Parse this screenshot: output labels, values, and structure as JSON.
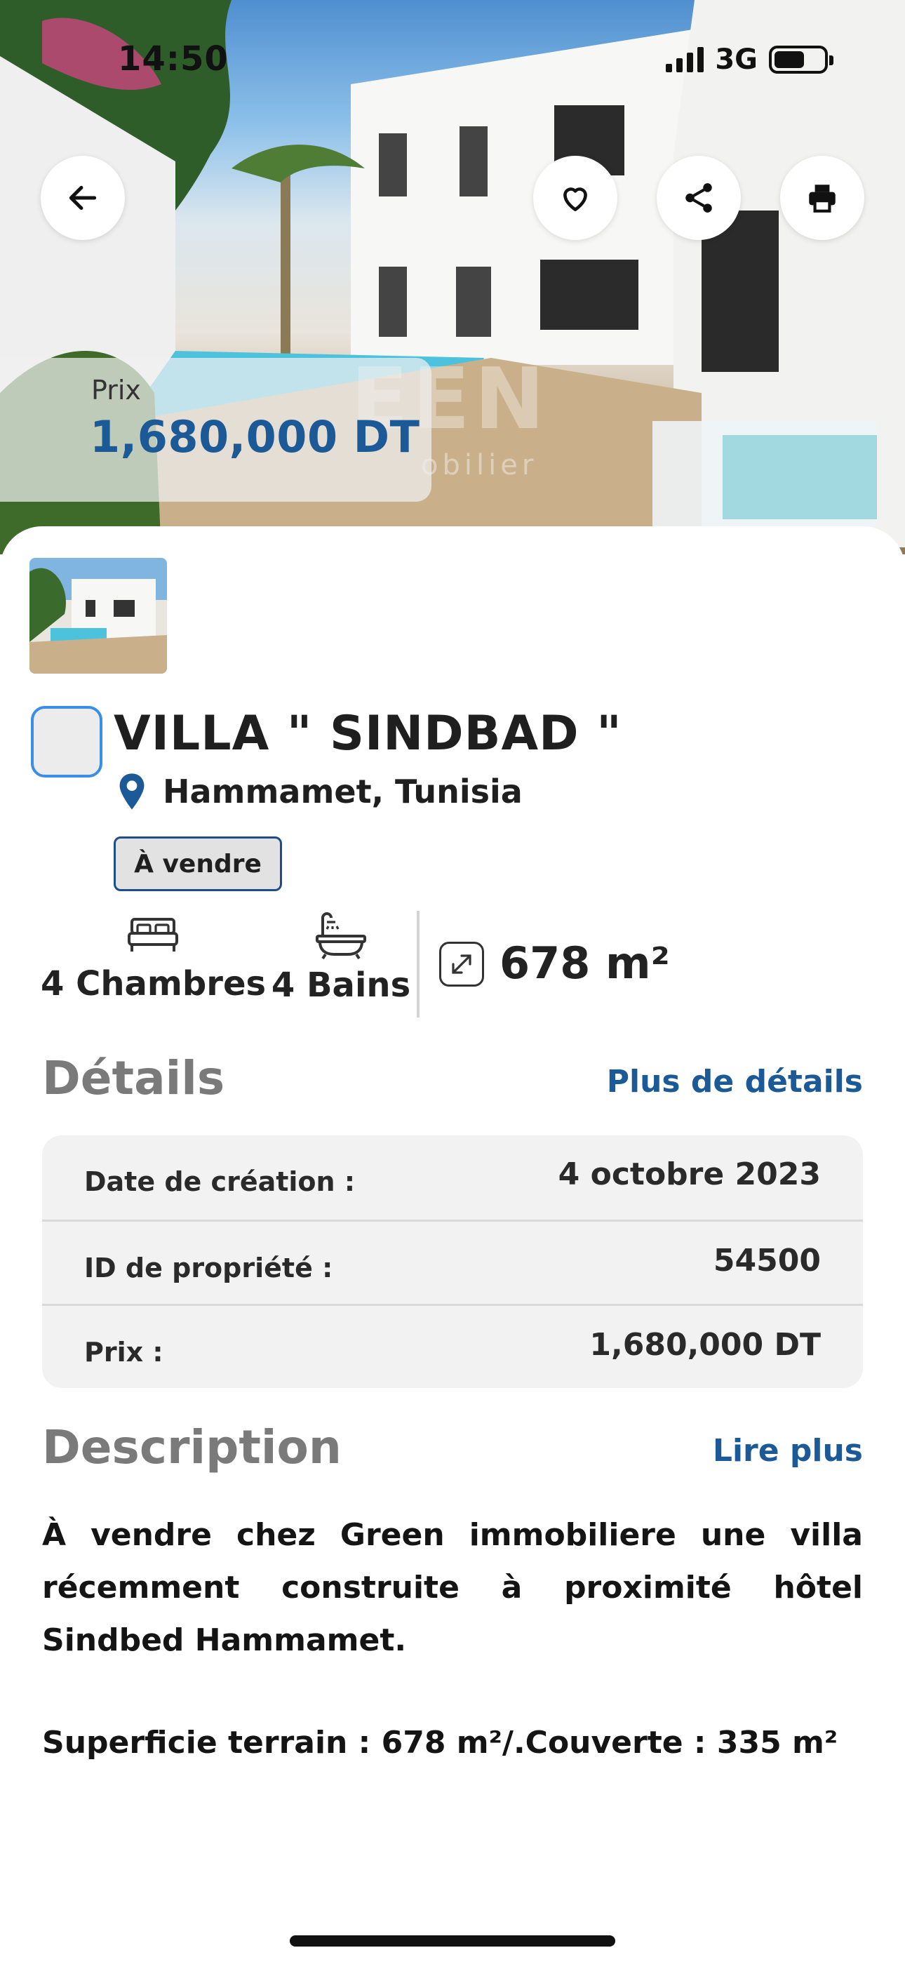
{
  "status_bar": {
    "time": "14:50",
    "network": "3G"
  },
  "hero": {
    "price_label": "Prix",
    "price_value": "1,680,000 DT",
    "watermark": "EEN",
    "watermark_sub": "obilier"
  },
  "listing": {
    "title": "VILLA \" SINDBAD \"",
    "location": "Hammamet, Tunisia",
    "status_badge": "À vendre",
    "bedrooms": "4 Chambres",
    "bathrooms": "4 Bains",
    "area": "678 m²"
  },
  "details": {
    "title": "Détails",
    "more_link": "Plus de détails",
    "rows": [
      {
        "key": "Date de création :",
        "value": "4 octobre 2023"
      },
      {
        "key": "ID de propriété :",
        "value": "54500"
      },
      {
        "key": "Prix :",
        "value": "1,680,000 DT"
      }
    ]
  },
  "description": {
    "title": "Description",
    "more_link": "Lire plus",
    "text": "À vendre chez Green immobiliere une villa récemment construite à proximité hôtel Sindbed Hammamet.",
    "surface": "Superficie terrain : 678 m²/.Couverte : 335 m²"
  },
  "colors": {
    "accent": "#1c5a97",
    "select_border": "#3a8ee6",
    "badge_border": "#1d4f86"
  },
  "icons": [
    "back-arrow-icon",
    "heart-icon",
    "share-icon",
    "print-icon",
    "location-pin-icon",
    "bed-icon",
    "bathtub-icon",
    "expand-arrows-icon"
  ]
}
